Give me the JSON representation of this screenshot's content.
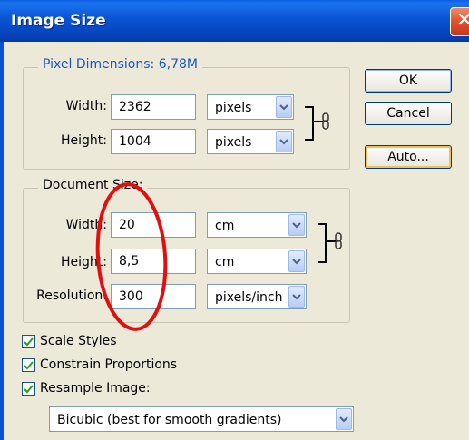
{
  "window": {
    "title": "Image Size",
    "close_glyph": "✕"
  },
  "pixel_dimensions": {
    "legend": "Pixel Dimensions:  6,78M",
    "width_label": "Width:",
    "width_value": "2362",
    "width_unit": "pixels",
    "height_label": "Height:",
    "height_value": "1004",
    "height_unit": "pixels"
  },
  "document_size": {
    "legend": "Document Size:",
    "width_label": "Width:",
    "width_value": "20",
    "width_unit": "cm",
    "height_label": "Height:",
    "height_value": "8,5",
    "height_unit": "cm",
    "resolution_label": "Resolution:",
    "resolution_value": "300",
    "resolution_unit": "pixels/inch"
  },
  "buttons": {
    "ok": "OK",
    "cancel": "Cancel",
    "auto": "Auto..."
  },
  "options": {
    "scale_styles": {
      "label": "Scale Styles",
      "checked": true
    },
    "constrain_proportions": {
      "label": "Constrain Proportions",
      "checked": true
    },
    "resample_image": {
      "label": "Resample Image:",
      "checked": true
    }
  },
  "resample_method": "Bicubic (best for smooth gradients)",
  "colors": {
    "accent_title": "#0a56d8",
    "legend_blue": "#1b55c4",
    "annotation_red": "#e01010"
  }
}
